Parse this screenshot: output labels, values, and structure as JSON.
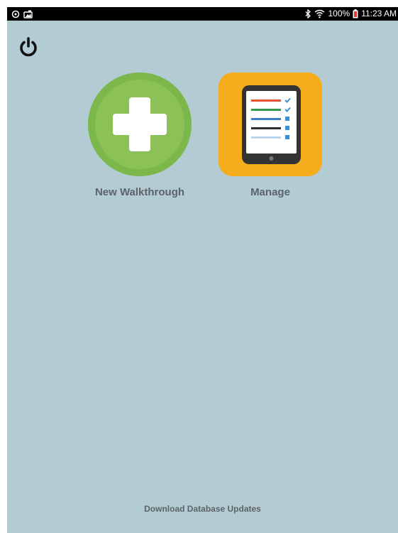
{
  "status_bar": {
    "left_icons": [
      "sync-icon",
      "photo-notification-icon"
    ],
    "battery_text": "100%",
    "time": "11:23 AM",
    "right_icons": [
      "bluetooth-icon",
      "wifi-icon",
      "battery-icon"
    ]
  },
  "toolbar": {
    "power_icon": "power-icon"
  },
  "tiles": [
    {
      "label": "New Walkthrough",
      "icon": "plus-icon",
      "color": "#8cc157"
    },
    {
      "label": "Manage",
      "icon": "tablet-checklist-icon",
      "color": "#f5ad1e"
    }
  ],
  "footer": {
    "download_label": "Download Database Updates"
  },
  "colors": {
    "background": "#b3cbd3",
    "label_text": "#5c6368",
    "green_outer": "#7bb74a",
    "green_inner": "#8cc157",
    "orange": "#f5ad1e"
  }
}
